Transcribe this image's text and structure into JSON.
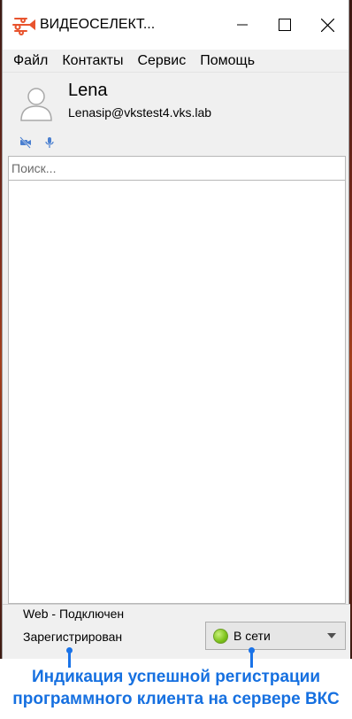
{
  "window": {
    "title": "ВИДЕОСЕЛЕКТ..."
  },
  "menu": {
    "items": [
      "Файл",
      "Контакты",
      "Сервис",
      "Помощь"
    ]
  },
  "profile": {
    "name": "Lena",
    "email": "Lenasip@vkstest4.vks.lab",
    "video_icon": "camera-off-icon",
    "mic_icon": "microphone-icon"
  },
  "search": {
    "placeholder": "Поиск..."
  },
  "status": {
    "web": "Web - Подключен",
    "registration": "Зарегистрирован",
    "presence": "В сети",
    "presence_color": "#7cc21a"
  },
  "annotation": {
    "line1": "Индикация успешной регистрации",
    "line2": "программного клиента на сервере ВКС",
    "color": "#1670e0"
  }
}
